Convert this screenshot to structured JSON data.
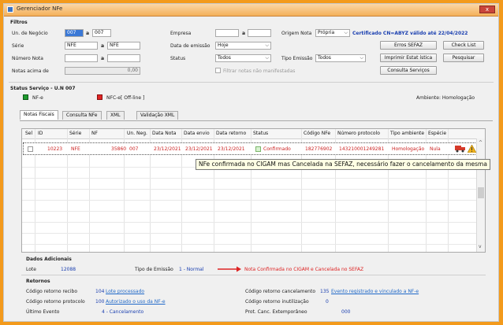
{
  "window": {
    "title": "Gerenciador NFe",
    "close": "x"
  },
  "filters": {
    "heading": "Filtros",
    "un_negocio_label": "Un. de Negócio",
    "un_from": "007",
    "un_a": "a",
    "un_to": "007",
    "serie_label": "Série",
    "serie_from": "NFE",
    "serie_a": "a",
    "serie_to": "NFE",
    "numero_label": "Número Nota",
    "numero_a": "a",
    "notas_acima_label": "Notas acima de",
    "notas_acima_value": "0,00",
    "empresa_label": "Empresa",
    "empresa_a": "a",
    "data_emissao_label": "Data de emissão",
    "data_emissao_value": "Hoje",
    "status_label": "Status",
    "status_value": "Todos",
    "tipo_emissao_label": "Tipo Emissão",
    "tipo_emissao_value": "Todos",
    "filtrar_label": "Filtrar notas não manifestadas",
    "origem_label": "Origem Nota",
    "origem_value": "Própria",
    "certificado": "Certificado CN=ABYZ válido até 22/04/2022"
  },
  "buttons": {
    "erros": "Erros SEFAZ",
    "check_list": "Check List",
    "imprimir": "Imprimir Estat ística",
    "pesquisar": "Pesquisar",
    "consulta": "Consulta Serviços"
  },
  "status_service": {
    "heading": "Status Serviço - U.N 007",
    "nfe": "NF-e",
    "nfce": "NFC-e",
    "offline": "[ Off-line ]",
    "ambiente": "Ambiente: Homologação",
    "nfe_color": "#1e9a2e",
    "nfce_color": "#e02424"
  },
  "tabs": [
    "Notas Fiscais",
    "Consulta NFe",
    "XML",
    "Validação XML"
  ],
  "grid": {
    "columns": [
      "Sel",
      "ID",
      "Série",
      "NF",
      "Un. Neg.",
      "Data Nota",
      "Data envio",
      "Data retorno",
      "Status",
      "Código NFe",
      "Número protocolo",
      "Tipo ambiente",
      "Espécie"
    ],
    "row": {
      "id": "10223",
      "serie": "NFE",
      "nf": "35860",
      "un": "007",
      "data_nota": "23/12/2021",
      "data_envio": "23/12/2021",
      "data_retorno": "23/12/2021",
      "status": "Confirmado",
      "codigo": "182776902",
      "protocolo": "143210001249281",
      "ambiente": "Homologação",
      "especie": "Nula"
    }
  },
  "tooltip": "NFe confirmada no CIGAM mas Cancelada na SEFAZ, necessário fazer o cancelamento da mesma",
  "dados": {
    "heading": "Dados Adicionais",
    "lote_label": "Lote",
    "lote_value": "12088",
    "tipo_label": "Tipo de Emissão",
    "tipo_value": "1 - Normal",
    "annotation": "Nota Confirmada no CIGAM e Cancelada no SEFAZ"
  },
  "retornos": {
    "heading": "Retornos",
    "recibo_label": "Código retorno recibo",
    "recibo_code": "104",
    "recibo_text": "Lote processado",
    "protocolo_label": "Código retorno protocolo",
    "protocolo_code": "100",
    "protocolo_text": "Autorizado o uso da NF-e",
    "evento_label": "Último Evento",
    "evento_value": "4 - Cancelamento",
    "cancel_label": "Código retorno cancelamento",
    "cancel_code": "135",
    "cancel_text": "Evento registrado e vinculado a NF-e",
    "inut_label": "Código retorno inutilização",
    "inut_code": "0",
    "extemp_label": "Prot. Canc. Extemporâneo",
    "extemp_value": "000"
  }
}
